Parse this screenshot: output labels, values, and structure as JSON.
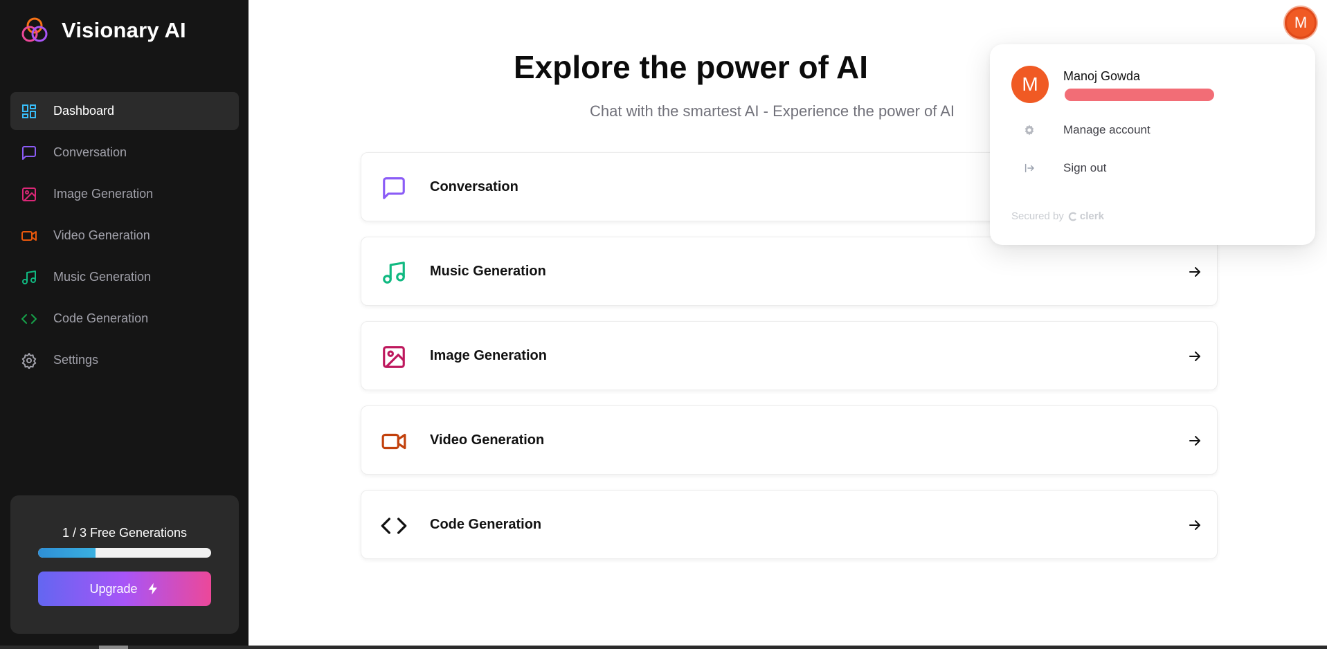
{
  "app": {
    "brand_name": "Visionary AI"
  },
  "sidebar": {
    "items": [
      {
        "label": "Dashboard",
        "icon": "dashboard-icon",
        "color": "#38bdf8",
        "active": true
      },
      {
        "label": "Conversation",
        "icon": "message-square-icon",
        "color": "#8b5cf6"
      },
      {
        "label": "Image Generation",
        "icon": "image-icon",
        "color": "#db2777"
      },
      {
        "label": "Video Generation",
        "icon": "video-icon",
        "color": "#ea580c"
      },
      {
        "label": "Music Generation",
        "icon": "music-icon",
        "color": "#10b981"
      },
      {
        "label": "Code Generation",
        "icon": "code-icon",
        "color": "#16a34a"
      },
      {
        "label": "Settings",
        "icon": "settings-icon",
        "color": "#a1a1aa"
      }
    ],
    "free_generations": {
      "text": "1 / 3 Free Generations",
      "used": 1,
      "total": 3
    },
    "upgrade_label": "Upgrade"
  },
  "main": {
    "title": "Explore the power of AI",
    "subtitle": "Chat with the smartest AI - Experience the power of AI",
    "cards": [
      {
        "label": "Conversation",
        "icon": "message-square-icon",
        "color": "#8b5cf6"
      },
      {
        "label": "Music Generation",
        "icon": "music-icon",
        "color": "#10b981"
      },
      {
        "label": "Image Generation",
        "icon": "image-icon",
        "color": "#be185d"
      },
      {
        "label": "Video Generation",
        "icon": "video-icon",
        "color": "#c2410c"
      },
      {
        "label": "Code Generation",
        "icon": "code-icon",
        "color": "#111111"
      }
    ]
  },
  "user": {
    "initial": "M",
    "name": "Manoj Gowda",
    "avatar_color": "#f05a24"
  },
  "account_menu": {
    "manage_label": "Manage account",
    "signout_label": "Sign out",
    "secured_by": "Secured by",
    "provider": "clerk"
  }
}
